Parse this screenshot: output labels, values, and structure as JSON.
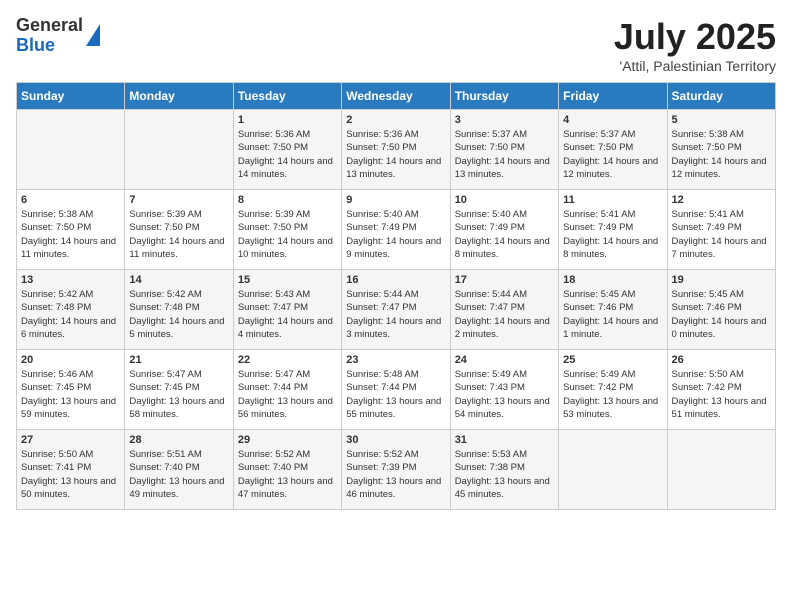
{
  "logo": {
    "general": "General",
    "blue": "Blue"
  },
  "title": "July 2025",
  "subtitle": "'Attil, Palestinian Territory",
  "days_header": [
    "Sunday",
    "Monday",
    "Tuesday",
    "Wednesday",
    "Thursday",
    "Friday",
    "Saturday"
  ],
  "weeks": [
    [
      {
        "day": "",
        "info": ""
      },
      {
        "day": "",
        "info": ""
      },
      {
        "day": "1",
        "info": "Sunrise: 5:36 AM\nSunset: 7:50 PM\nDaylight: 14 hours and 14 minutes."
      },
      {
        "day": "2",
        "info": "Sunrise: 5:36 AM\nSunset: 7:50 PM\nDaylight: 14 hours and 13 minutes."
      },
      {
        "day": "3",
        "info": "Sunrise: 5:37 AM\nSunset: 7:50 PM\nDaylight: 14 hours and 13 minutes."
      },
      {
        "day": "4",
        "info": "Sunrise: 5:37 AM\nSunset: 7:50 PM\nDaylight: 14 hours and 12 minutes."
      },
      {
        "day": "5",
        "info": "Sunrise: 5:38 AM\nSunset: 7:50 PM\nDaylight: 14 hours and 12 minutes."
      }
    ],
    [
      {
        "day": "6",
        "info": "Sunrise: 5:38 AM\nSunset: 7:50 PM\nDaylight: 14 hours and 11 minutes."
      },
      {
        "day": "7",
        "info": "Sunrise: 5:39 AM\nSunset: 7:50 PM\nDaylight: 14 hours and 11 minutes."
      },
      {
        "day": "8",
        "info": "Sunrise: 5:39 AM\nSunset: 7:50 PM\nDaylight: 14 hours and 10 minutes."
      },
      {
        "day": "9",
        "info": "Sunrise: 5:40 AM\nSunset: 7:49 PM\nDaylight: 14 hours and 9 minutes."
      },
      {
        "day": "10",
        "info": "Sunrise: 5:40 AM\nSunset: 7:49 PM\nDaylight: 14 hours and 8 minutes."
      },
      {
        "day": "11",
        "info": "Sunrise: 5:41 AM\nSunset: 7:49 PM\nDaylight: 14 hours and 8 minutes."
      },
      {
        "day": "12",
        "info": "Sunrise: 5:41 AM\nSunset: 7:49 PM\nDaylight: 14 hours and 7 minutes."
      }
    ],
    [
      {
        "day": "13",
        "info": "Sunrise: 5:42 AM\nSunset: 7:48 PM\nDaylight: 14 hours and 6 minutes."
      },
      {
        "day": "14",
        "info": "Sunrise: 5:42 AM\nSunset: 7:48 PM\nDaylight: 14 hours and 5 minutes."
      },
      {
        "day": "15",
        "info": "Sunrise: 5:43 AM\nSunset: 7:47 PM\nDaylight: 14 hours and 4 minutes."
      },
      {
        "day": "16",
        "info": "Sunrise: 5:44 AM\nSunset: 7:47 PM\nDaylight: 14 hours and 3 minutes."
      },
      {
        "day": "17",
        "info": "Sunrise: 5:44 AM\nSunset: 7:47 PM\nDaylight: 14 hours and 2 minutes."
      },
      {
        "day": "18",
        "info": "Sunrise: 5:45 AM\nSunset: 7:46 PM\nDaylight: 14 hours and 1 minute."
      },
      {
        "day": "19",
        "info": "Sunrise: 5:45 AM\nSunset: 7:46 PM\nDaylight: 14 hours and 0 minutes."
      }
    ],
    [
      {
        "day": "20",
        "info": "Sunrise: 5:46 AM\nSunset: 7:45 PM\nDaylight: 13 hours and 59 minutes."
      },
      {
        "day": "21",
        "info": "Sunrise: 5:47 AM\nSunset: 7:45 PM\nDaylight: 13 hours and 58 minutes."
      },
      {
        "day": "22",
        "info": "Sunrise: 5:47 AM\nSunset: 7:44 PM\nDaylight: 13 hours and 56 minutes."
      },
      {
        "day": "23",
        "info": "Sunrise: 5:48 AM\nSunset: 7:44 PM\nDaylight: 13 hours and 55 minutes."
      },
      {
        "day": "24",
        "info": "Sunrise: 5:49 AM\nSunset: 7:43 PM\nDaylight: 13 hours and 54 minutes."
      },
      {
        "day": "25",
        "info": "Sunrise: 5:49 AM\nSunset: 7:42 PM\nDaylight: 13 hours and 53 minutes."
      },
      {
        "day": "26",
        "info": "Sunrise: 5:50 AM\nSunset: 7:42 PM\nDaylight: 13 hours and 51 minutes."
      }
    ],
    [
      {
        "day": "27",
        "info": "Sunrise: 5:50 AM\nSunset: 7:41 PM\nDaylight: 13 hours and 50 minutes."
      },
      {
        "day": "28",
        "info": "Sunrise: 5:51 AM\nSunset: 7:40 PM\nDaylight: 13 hours and 49 minutes."
      },
      {
        "day": "29",
        "info": "Sunrise: 5:52 AM\nSunset: 7:40 PM\nDaylight: 13 hours and 47 minutes."
      },
      {
        "day": "30",
        "info": "Sunrise: 5:52 AM\nSunset: 7:39 PM\nDaylight: 13 hours and 46 minutes."
      },
      {
        "day": "31",
        "info": "Sunrise: 5:53 AM\nSunset: 7:38 PM\nDaylight: 13 hours and 45 minutes."
      },
      {
        "day": "",
        "info": ""
      },
      {
        "day": "",
        "info": ""
      }
    ]
  ]
}
